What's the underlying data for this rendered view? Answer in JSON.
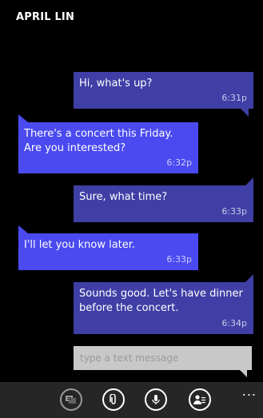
{
  "header": {
    "title": "APRIL LIN"
  },
  "messages": [
    {
      "text": "Hi, what's up?",
      "time": "6:31p"
    },
    {
      "text": "There's a concert this Friday. Are you interested?",
      "time": "6:32p"
    },
    {
      "text": "Sure, what time?",
      "time": "6:33p"
    },
    {
      "text": "I'll let you know later.",
      "time": "6:33p"
    },
    {
      "text": "Sounds good. Let's have dinner before the concert.",
      "time": "6:34p"
    }
  ],
  "composer": {
    "placeholder": "type a text message"
  },
  "appbar": {
    "icons": [
      "switch-conversation-icon",
      "attach-icon",
      "microphone-icon",
      "contact-icon"
    ],
    "more": "..."
  },
  "colors": {
    "sent": "#3f3fa6",
    "received": "#4a4af0",
    "background": "#000000",
    "appbar": "#262626"
  }
}
